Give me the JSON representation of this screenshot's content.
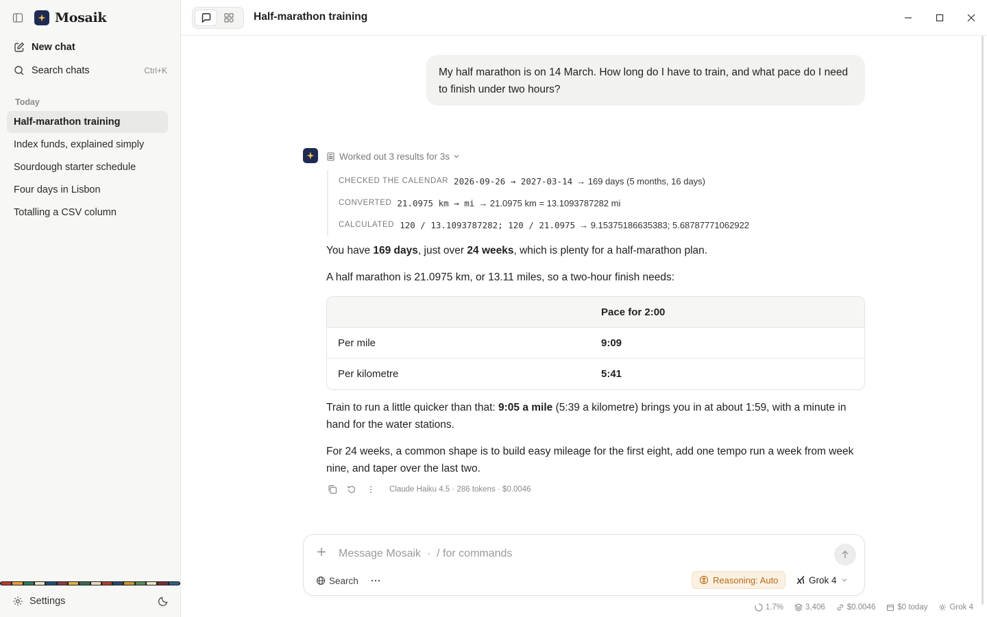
{
  "app": {
    "name": "Mosaik"
  },
  "sidebar": {
    "new_chat": "New chat",
    "search_chats": "Search chats",
    "search_shortcut": "Ctrl+K",
    "section_today": "Today",
    "chats": [
      {
        "label": "Half-marathon training",
        "active": true
      },
      {
        "label": "Index funds, explained simply",
        "active": false
      },
      {
        "label": "Sourdough starter schedule",
        "active": false
      },
      {
        "label": "Four days in Lisbon",
        "active": false
      },
      {
        "label": "Totalling a CSV column",
        "active": false
      }
    ],
    "settings": "Settings",
    "stripe_colors": [
      "#c0392b",
      "#e6a23c",
      "#2e7d5b",
      "#f0e6c8",
      "#1f4e79",
      "#8e3b46",
      "#d9b44a",
      "#3d6b4f",
      "#e8dcc0",
      "#a8432f",
      "#27496d",
      "#c99a2e",
      "#5b8c5a",
      "#ede3c6",
      "#7a2e3a",
      "#2f5f8a"
    ]
  },
  "topbar": {
    "title": "Half-marathon training"
  },
  "conversation": {
    "user_message": "My half marathon is on 14 March. How long do I have to train, and what pace do I need to finish under two hours?",
    "worked_out": "Worked out 3 results for 3s",
    "tools": [
      {
        "tag": "CHECKED THE CALENDAR",
        "expr": "2026-09-26 → 2027-03-14",
        "result": "→ 169 days (5 months, 16 days)"
      },
      {
        "tag": "CONVERTED",
        "expr": "21.0975 km → mi",
        "result": "→ 21.0975 km = 13.1093787282 mi"
      },
      {
        "tag": "CALCULATED",
        "expr": "120 / 13.1093787282; 120 / 21.0975",
        "result": "→ 9.15375186635383; 5.68787771062922"
      }
    ],
    "p1": {
      "a": "You have ",
      "b": "169 days",
      "c": ", just over ",
      "d": "24 weeks",
      "e": ", which is plenty for a half-marathon plan."
    },
    "p2": "A half marathon is 21.0975 km, or 13.11 miles, so a two-hour finish needs:",
    "table": {
      "headers": [
        "",
        "Pace for 2:00"
      ],
      "rows": [
        {
          "label": "Per mile",
          "value": "9:09"
        },
        {
          "label": "Per kilometre",
          "value": "5:41"
        }
      ]
    },
    "p3": {
      "a": "Train to run a little quicker than that: ",
      "b": "9:05 a mile",
      "c": " (5:39 a kilometre) brings you in at about 1:59, with a minute in hand for the water stations."
    },
    "p4": "For 24 weeks, a common shape is to build easy mileage for the first eight, add one tempo run a week from week nine, and taper over the last two.",
    "meta": "Claude Haiku 4.5 · 286 tokens · $0.0046"
  },
  "composer": {
    "placeholder": "Message Mosaik  ·  / for commands",
    "search": "Search",
    "reasoning": "Reasoning: Auto",
    "model": "Grok 4"
  },
  "status": {
    "context": "1.7%",
    "tokens": "3,406",
    "cost": "$0.0046",
    "today": "$0 today",
    "model": "Grok 4"
  }
}
